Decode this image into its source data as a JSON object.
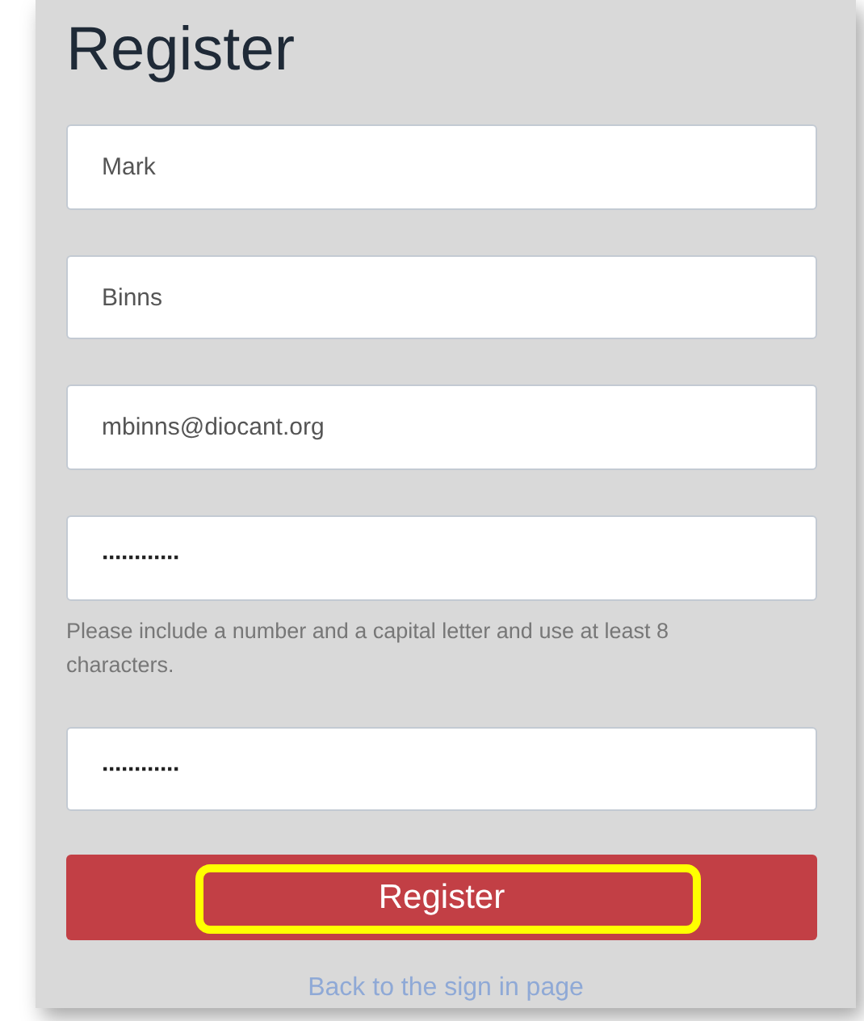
{
  "title": "Register",
  "fields": [
    {
      "kind": "text",
      "value": "Mark"
    },
    {
      "kind": "text",
      "value": "Binns"
    },
    {
      "kind": "text",
      "value": "mbinns@diocant.org"
    },
    {
      "kind": "password",
      "value": "············",
      "hint": "Please include a number and a capital letter and use at least 8 characters."
    },
    {
      "kind": "password",
      "value": "············"
    }
  ],
  "submit_button": {
    "label": "Register",
    "highlighted": true
  },
  "back_link": "Back to the sign in page"
}
